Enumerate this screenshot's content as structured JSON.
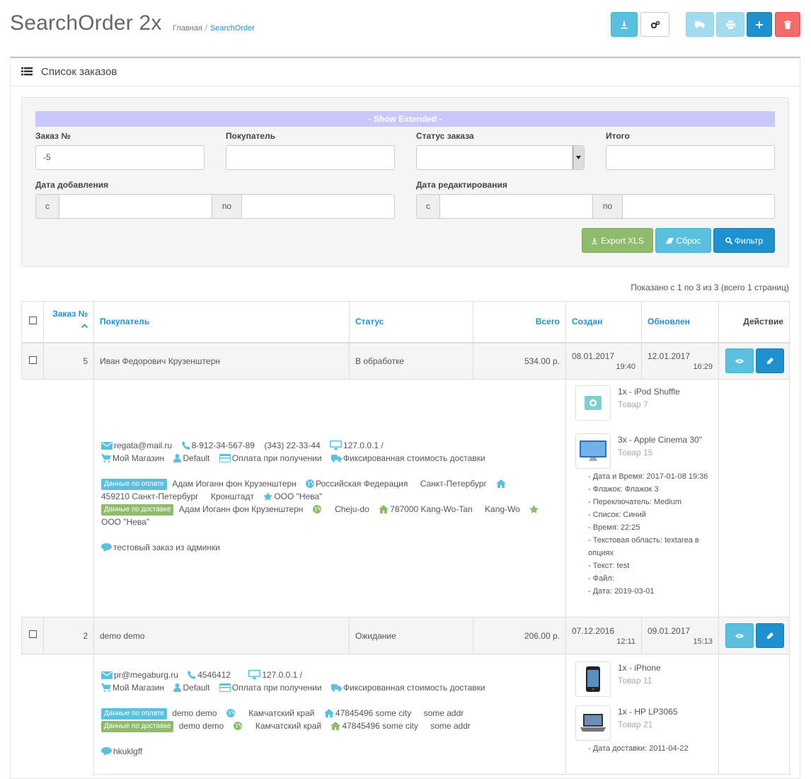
{
  "header": {
    "title": "SearchOrder 2x",
    "breadcrumb": [
      "Главная",
      "SearchOrder"
    ]
  },
  "panel": {
    "title": "Список заказов"
  },
  "filter": {
    "show_extended": "- Show Extended -",
    "order_label": "Заказ №",
    "order_value": "-5",
    "customer_label": "Покупатель",
    "status_label": "Статус заказа",
    "total_label": "Итого",
    "date_added_label": "Дата добавления",
    "date_modified_label": "Дата редактирования",
    "from": "с",
    "to": "по",
    "export_label": "Export XLS",
    "reset_label": "Сброс",
    "filter_label": "Фильтр"
  },
  "pager": "Показано с 1 по 3 из 3 (всего 1 страниц)",
  "columns": {
    "order": "Заказ №",
    "customer": "Покупатель",
    "status": "Статус",
    "total": "Всего",
    "created": "Создан",
    "updated": "Обновлен",
    "action": "Действие"
  },
  "orders": [
    {
      "id": "5",
      "customer": "Иван Федорович Крузенштерн",
      "status": "В обработке",
      "total": "534.00 р.",
      "created_date": "08.01.2017",
      "created_time": "19:40",
      "updated_date": "12.01.2017",
      "updated_time": "16:29",
      "email": "regata@mail.ru",
      "phone": "8-912-34-567-89",
      "fax": "(343) 22-33-44",
      "ip": "127.0.0.1 /",
      "store": "Мой Магазин",
      "group": "Default",
      "payment_method": "Оплата при получении",
      "shipping_method": "Фиксированная стоимость доставки",
      "payment_badge": "Данные по оплате",
      "payment_name": "Адам Иоганн фон Крузенштерн",
      "payment_country": "Российская Федерация",
      "payment_zone": "Санкт-Петербург",
      "payment_address": "459210 Санкт-Петербург",
      "payment_city": "Кронштадт",
      "payment_company": "ООО \"Нева\"",
      "shipping_badge": "Данные по доставке",
      "shipping_name": "Адам Иоганн фон Крузенштерн",
      "shipping_zone": "Cheju-do",
      "shipping_address": "787000 Kang-Wo-Tan",
      "shipping_city": "Kang-Wo",
      "shipping_company": "ООО \"Нева\"",
      "comment": "тестовый заказ из админки",
      "products": [
        {
          "name": "1x - iPod Shuffle",
          "model": "Товар 7"
        },
        {
          "name": "3x - Apple Cinema 30\"",
          "model": "Товар 15"
        }
      ],
      "options": [
        "- Дата и Время: 2017-01-08 19:36",
        "- Флажок: Флажок 3",
        "- Переключатель: Medium",
        "- Список: Синий",
        "- Время: 22:25",
        "- Текстовая область: textarea в",
        "опциях",
        "- Текст: test",
        "- Файл:",
        "- Дата: 2019-03-01"
      ]
    },
    {
      "id": "2",
      "customer": "demo demo",
      "status": "Ожидание",
      "total": "206.00 р.",
      "created_date": "07.12.2016",
      "created_time": "12:11",
      "updated_date": "09.01.2017",
      "updated_time": "15:13",
      "email": "pr@megaburg.ru",
      "phone": "4546412",
      "ip": "127.0.0.1 /",
      "store": "Мой Магазин",
      "group": "Default",
      "payment_method": "Оплата при получении",
      "shipping_method": "Фиксированная стоимость доставки",
      "payment_badge": "Данные по оплате",
      "payment_name": "demo demo",
      "payment_zone": "Камчатский край",
      "payment_address": "47845496 some city",
      "payment_addr2": "some addr",
      "shipping_badge": "Данные по доставке",
      "shipping_name": "demo demo",
      "shipping_zone": "Камчатский край",
      "shipping_address": "47845496 some city",
      "shipping_addr2": "some addr",
      "comment": "hkuklgff",
      "products": [
        {
          "name": "1x - iPhone",
          "model": "Товар 11"
        },
        {
          "name": "1x - HP LP3065",
          "model": "Товар 21"
        }
      ],
      "options": [
        "- Дата доставки: 2011-04-22"
      ]
    }
  ],
  "colors": {
    "primary": "#1e91cf",
    "info": "#5bc0de",
    "success": "#8fbb6c",
    "danger": "#f56b6b",
    "show_extended_bg": "#c8c8fa"
  }
}
